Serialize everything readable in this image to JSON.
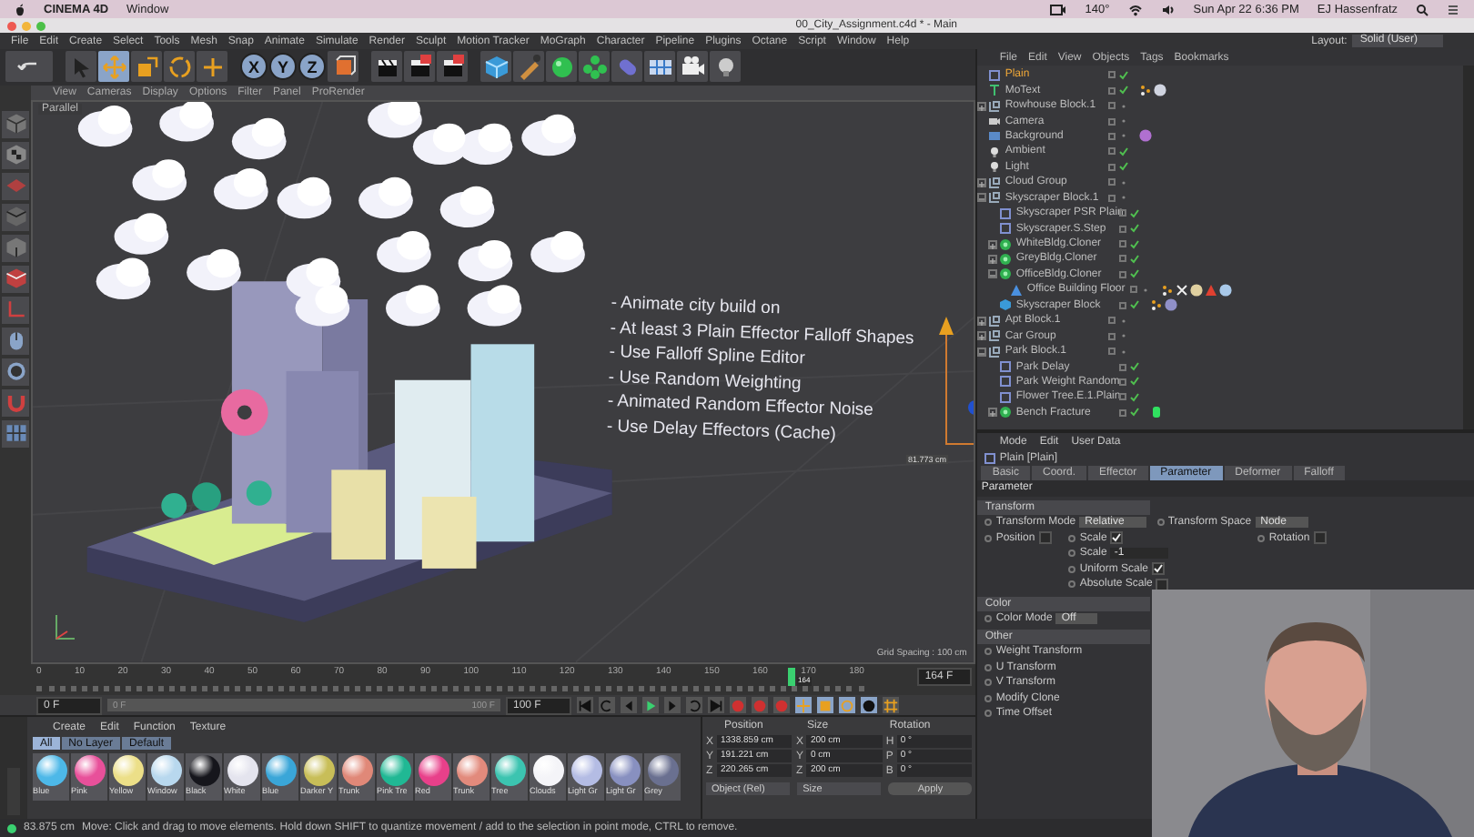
{
  "mac_menubar": {
    "app": "CINEMA 4D",
    "menus": [
      "Window"
    ],
    "temperature": "140°",
    "clock": "Sun Apr 22  6:36 PM",
    "user": "EJ Hassenfratz"
  },
  "window": {
    "title": "00_City_Assignment.c4d * - Main"
  },
  "menu": [
    "File",
    "Edit",
    "Create",
    "Select",
    "Tools",
    "Mesh",
    "Snap",
    "Animate",
    "Simulate",
    "Render",
    "Sculpt",
    "Motion Tracker",
    "MoGraph",
    "Character",
    "Pipeline",
    "Plugins",
    "Octane",
    "Script",
    "Window",
    "Help"
  ],
  "layout": {
    "label": "Layout:",
    "value": "Solid (User)"
  },
  "axis_buttons": [
    "X",
    "Y",
    "Z"
  ],
  "viewport": {
    "menu": [
      "View",
      "Cameras",
      "Display",
      "Options",
      "Filter",
      "Panel",
      "ProRender"
    ],
    "camera": "Parallel",
    "notes": [
      "- Animate city build on",
      "- At least 3 Plain Effector Falloff Shapes",
      "- Use Falloff Spline Editor",
      "- Use Random Weighting",
      "- Animated Random Effector Noise",
      "- Use Delay Effectors (Cache)"
    ],
    "measure": "81.773 cm",
    "grid": "Grid Spacing : 100 cm"
  },
  "timeline": {
    "ticks": [
      "0",
      "10",
      "20",
      "30",
      "40",
      "50",
      "60",
      "70",
      "80",
      "90",
      "100",
      "110",
      "120",
      "130",
      "140",
      "150",
      "160",
      "170",
      "180"
    ],
    "current": "164",
    "level": 0.911,
    "frame": "164 F"
  },
  "transport": {
    "level": 1,
    "start": "0 F",
    "range_start": "0 F",
    "range_end": "100 F",
    "end": "100 F"
  },
  "materials": {
    "menu": [
      "Create",
      "Edit",
      "Function",
      "Texture"
    ],
    "filters": [
      {
        "label": "All",
        "selected": true
      },
      {
        "label": "No Layer",
        "selected": false
      },
      {
        "label": "Default",
        "selected": false
      }
    ],
    "items": [
      {
        "name": "Blue",
        "color": "#4db8e8"
      },
      {
        "name": "Pink",
        "color": "#e8509a"
      },
      {
        "name": "Yellow",
        "color": "#ecdf88"
      },
      {
        "name": "Window",
        "color": "#b8d8ee"
      },
      {
        "name": "Black",
        "color": "#16161c"
      },
      {
        "name": "White",
        "color": "#e4e4ee"
      },
      {
        "name": "Blue",
        "color": "#3aa6d8"
      },
      {
        "name": "Darker Y",
        "color": "#c8be58"
      },
      {
        "name": "Trunk",
        "color": "#e08878"
      },
      {
        "name": "Pink Tre",
        "color": "#20b894"
      },
      {
        "name": "Red",
        "color": "#e8408a"
      },
      {
        "name": "Trunk",
        "color": "#e28a7c"
      },
      {
        "name": "Tree",
        "color": "#3cc4b0"
      },
      {
        "name": "Clouds",
        "color": "#f4f4f8"
      },
      {
        "name": "Light Gr",
        "color": "#b4bce4"
      },
      {
        "name": "Light Gr",
        "color": "#8890c0"
      },
      {
        "name": "Grey",
        "color": "#6a7090"
      }
    ]
  },
  "coordinates": {
    "headers": [
      "Position",
      "Size",
      "Rotation"
    ],
    "rows": [
      {
        "axis": "X",
        "position": "1338.859 cm",
        "size_axis": "X",
        "size": "200 cm",
        "rotation_axis": "H",
        "rotation": "0 °"
      },
      {
        "axis": "Y",
        "position": "191.221 cm",
        "size_axis": "Y",
        "size": "0 cm",
        "rotation_axis": "P",
        "rotation": "0 °"
      },
      {
        "axis": "Z",
        "position": "220.265 cm",
        "size_axis": "Z",
        "size": "200 cm",
        "rotation_axis": "B",
        "rotation": "0 °"
      }
    ],
    "mode": "Object (Rel)",
    "size_mode": "Size",
    "apply": "Apply"
  },
  "objects": {
    "menu": [
      "File",
      "Edit",
      "View",
      "Objects",
      "Tags",
      "Bookmarks"
    ],
    "items": [
      {
        "name": "Plain",
        "kind": "effector",
        "selected": true,
        "enabled": true
      },
      {
        "name": "MoText",
        "kind": "text",
        "selected": false,
        "enabled": true,
        "tags": [
          {
            "kind": "mograph"
          },
          {
            "kind": "material",
            "color": "#d0d4e0"
          }
        ]
      },
      {
        "name": "Rowhouse Block.1",
        "kind": "null",
        "selected": false,
        "enabled": false,
        "expanded": false
      },
      {
        "name": "Camera",
        "kind": "camera",
        "selected": false,
        "enabled": false
      },
      {
        "name": "Background",
        "kind": "background",
        "selected": false,
        "enabled": false,
        "tags": [
          {
            "kind": "material",
            "color": "#b070d0"
          }
        ]
      },
      {
        "name": "Ambient",
        "kind": "light",
        "selected": false,
        "enabled": true
      },
      {
        "name": "Light",
        "kind": "light",
        "selected": false,
        "enabled": true
      },
      {
        "name": "Cloud Group",
        "kind": "null",
        "selected": false,
        "enabled": false,
        "expanded": false
      },
      {
        "name": "Skyscraper Block.1",
        "kind": "null",
        "selected": false,
        "enabled": false,
        "expanded": true,
        "children": [
          {
            "name": "Skyscraper PSR Plain",
            "kind": "effector",
            "selected": false,
            "enabled": true
          },
          {
            "name": "Skyscraper.S.Step",
            "kind": "effector",
            "selected": false,
            "enabled": true
          },
          {
            "name": "WhiteBldg.Cloner",
            "kind": "cloner",
            "selected": false,
            "enabled": true,
            "expanded": false
          },
          {
            "name": "GreyBldg.Cloner",
            "kind": "cloner",
            "selected": false,
            "enabled": true,
            "expanded": false
          },
          {
            "name": "OfficeBldg.Cloner",
            "kind": "cloner",
            "selected": false,
            "enabled": true,
            "expanded": true,
            "children": [
              {
                "name": "Office Building Floor",
                "kind": "cone",
                "selected": false,
                "enabled": false,
                "tags": [
                  {
                    "kind": "mograph"
                  },
                  {
                    "kind": "selection"
                  },
                  {
                    "kind": "material",
                    "color": "#e0d0a0"
                  },
                  {
                    "kind": "warning"
                  },
                  {
                    "kind": "material",
                    "color": "#a8c8e8"
                  }
                ]
              }
            ]
          },
          {
            "name": "Skyscraper Block",
            "kind": "cube",
            "selected": false,
            "enabled": true,
            "tags": [
              {
                "kind": "mograph"
              },
              {
                "kind": "material",
                "color": "#9090c8"
              }
            ]
          }
        ]
      },
      {
        "name": "Apt Block.1",
        "kind": "null",
        "selected": false,
        "enabled": false,
        "expanded": false
      },
      {
        "name": "Car Group",
        "kind": "null",
        "selected": false,
        "enabled": false,
        "expanded": false
      },
      {
        "name": "Park Block.1",
        "kind": "null",
        "selected": false,
        "enabled": false,
        "expanded": true,
        "children": [
          {
            "name": "Park Delay",
            "kind": "effector",
            "selected": false,
            "enabled": true
          },
          {
            "name": "Park Weight Random",
            "kind": "effector",
            "selected": false,
            "enabled": true
          },
          {
            "name": "Flower Tree.E.1.Plain",
            "kind": "effector",
            "selected": false,
            "enabled": true
          },
          {
            "name": "Bench Fracture",
            "kind": "cloner",
            "selected": false,
            "enabled": true,
            "expanded": false,
            "tags": [
              {
                "kind": "fill"
              }
            ]
          }
        ]
      }
    ]
  },
  "attributes": {
    "menu": [
      "Mode",
      "Edit",
      "User Data"
    ],
    "object": "Plain [Plain]",
    "tabs": [
      {
        "label": "Basic",
        "selected": false
      },
      {
        "label": "Coord.",
        "selected": false
      },
      {
        "label": "Effector",
        "selected": false
      },
      {
        "label": "Parameter",
        "selected": true
      },
      {
        "label": "Deformer",
        "selected": false
      },
      {
        "label": "Falloff",
        "selected": false
      }
    ],
    "heading": "Parameter",
    "sections": [
      {
        "title": "Transform",
        "rows": [
          [
            {
              "label": "Transform Mode",
              "kind": "dropdown",
              "value": "Relative"
            },
            {
              "label": "Transform Space",
              "kind": "dropdown",
              "value": "Node"
            },
            null
          ],
          [
            {
              "label": "Position",
              "kind": "check",
              "checked": false
            },
            {
              "label": "Scale",
              "kind": "check",
              "checked": true
            },
            {
              "label": "Rotation",
              "kind": "check",
              "checked": false
            }
          ],
          [
            null,
            {
              "label": "Scale",
              "kind": "number",
              "value": "-1"
            },
            null
          ],
          [
            null,
            {
              "label": "Uniform Scale",
              "kind": "check",
              "checked": true
            },
            null
          ],
          [
            null,
            {
              "label": "Absolute Scale",
              "kind": "check",
              "checked": false
            },
            null
          ]
        ]
      },
      {
        "title": "Color",
        "rows": [
          [
            {
              "label": "Color Mode",
              "kind": "dropdown",
              "value": "Off"
            },
            null,
            null
          ]
        ]
      },
      {
        "title": "Other",
        "rows": [
          [
            {
              "label": "Weight Transform",
              "kind": "label"
            },
            null,
            null
          ],
          [
            {
              "label": "U Transform",
              "kind": "label"
            },
            null,
            null
          ],
          [
            {
              "label": "V Transform",
              "kind": "label"
            },
            null,
            null
          ],
          [
            {
              "label": "Modify Clone",
              "kind": "label"
            },
            null,
            null
          ],
          [
            {
              "label": "Time Offset",
              "kind": "label"
            },
            null,
            null
          ]
        ]
      }
    ]
  },
  "webcam": {
    "kind": "picture"
  },
  "status_bar": {
    "distance": "83.875 cm",
    "hint": "Move: Click and drag to move elements. Hold down SHIFT to quantize movement / add to the selection in point mode, CTRL to remove."
  }
}
